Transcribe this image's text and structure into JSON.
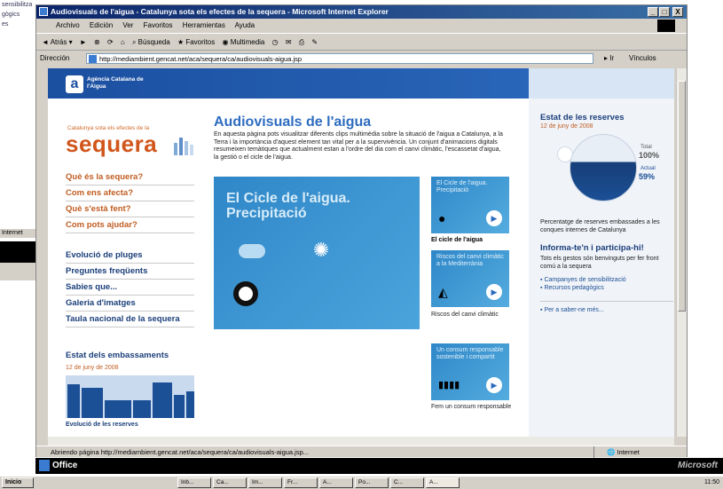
{
  "background_window": {
    "lines": [
      "sensibilitza",
      "gògics",
      "es"
    ],
    "bar_label": "Internet"
  },
  "window": {
    "title": "Audiovisuals de l'aigua - Catalunya sota els efectes de la sequera - Microsoft Internet Explorer",
    "minimize": "_",
    "maximize": "□",
    "close": "X",
    "menu": [
      "Archivo",
      "Edición",
      "Ver",
      "Favoritos",
      "Herramientas",
      "Ayuda"
    ],
    "toolbar": {
      "back": "Atrás",
      "search": "Búsqueda",
      "favorites": "Favoritos",
      "multimedia": "Multimedia"
    },
    "address": {
      "label": "Dirección",
      "url": "http://mediambient.gencat.net/aca/sequera/ca/audiovisuals-aigua.jsp",
      "go": "Ir",
      "links": "Vínculos"
    },
    "status": {
      "text": "Abriendo página http://mediambient.gencat.net/aca/sequera/ca/audiovisuals-aigua.jsp...",
      "zone": "Internet"
    }
  },
  "page": {
    "logo_text": "Agència Catalana de l'Aigua",
    "logo_letter": "a",
    "brand_small": "Catalunya sota els efectes de la",
    "brand": "sequera",
    "nav_primary": [
      "Què és la sequera?",
      "Com ens afecta?",
      "Què s'està fent?",
      "Com pots ajudar?"
    ],
    "nav_secondary": [
      "Evolució de pluges",
      "Preguntes freqüents",
      "Sabies que...",
      "Galeria d'imatges",
      "Taula nacional de la sequera"
    ],
    "estat_embassaments": {
      "title": "Estat dels embassaments",
      "date": "12 de juny de 2008",
      "label": "Evolució de les reserves"
    },
    "main": {
      "title": "Audiovisuals de l'aigua",
      "description": "En aquesta pàgina pots visualitzar diferents clips multimèdia sobre la situació de l'aigua a Catalunya, a la Terra i la importància d'aquest element tan vital per a la supervivència. Un conjunt d'animacions digitals resumeixen temàtiques que actualment estan a l'ordre del dia com el canvi climàtic, l'escassetat d'aigua, la gestió o el cicle de l'aigua.",
      "video_title": "El Cicle de l'aigua. Precipitació",
      "thumbs": [
        {
          "title": "El Cicle de l'aigua. Precipitació",
          "caption": "El cicle de l'aigua"
        },
        {
          "title": "Riscos del canvi climàtic a la Mediterrània",
          "caption": "Riscos del canvi climàtic"
        },
        {
          "title": "Un consum responsable sostenible i compartit",
          "caption": "Fem un consum responsable"
        }
      ]
    },
    "reserves": {
      "title": "Estat de les reserves",
      "date": "12 de juny de 2008",
      "total_label": "Total",
      "total_value": "100%",
      "actual_label": "Actual",
      "actual_value": "59%",
      "fill_fraction": 0.59,
      "text": "Percentatge de reserves embassades a les conques internes de Catalunya",
      "info_title": "Informa-te'n i participa-hi!",
      "info_text": "Tots els gestos són benvinguts per fer front comú a la sequera",
      "links": [
        "Campanyes de sensibilització",
        "Recursos pedagògics",
        "Per a saber-ne més..."
      ]
    }
  },
  "office_bar": {
    "label": "Office",
    "brand": "Microsoft"
  },
  "taskbar": {
    "start": "Inicio",
    "tasks": [
      "Inb...",
      "Ca...",
      "Im...",
      "Fr...",
      "A...",
      "Po...",
      "C...",
      "A..."
    ],
    "clock": "11:50"
  }
}
